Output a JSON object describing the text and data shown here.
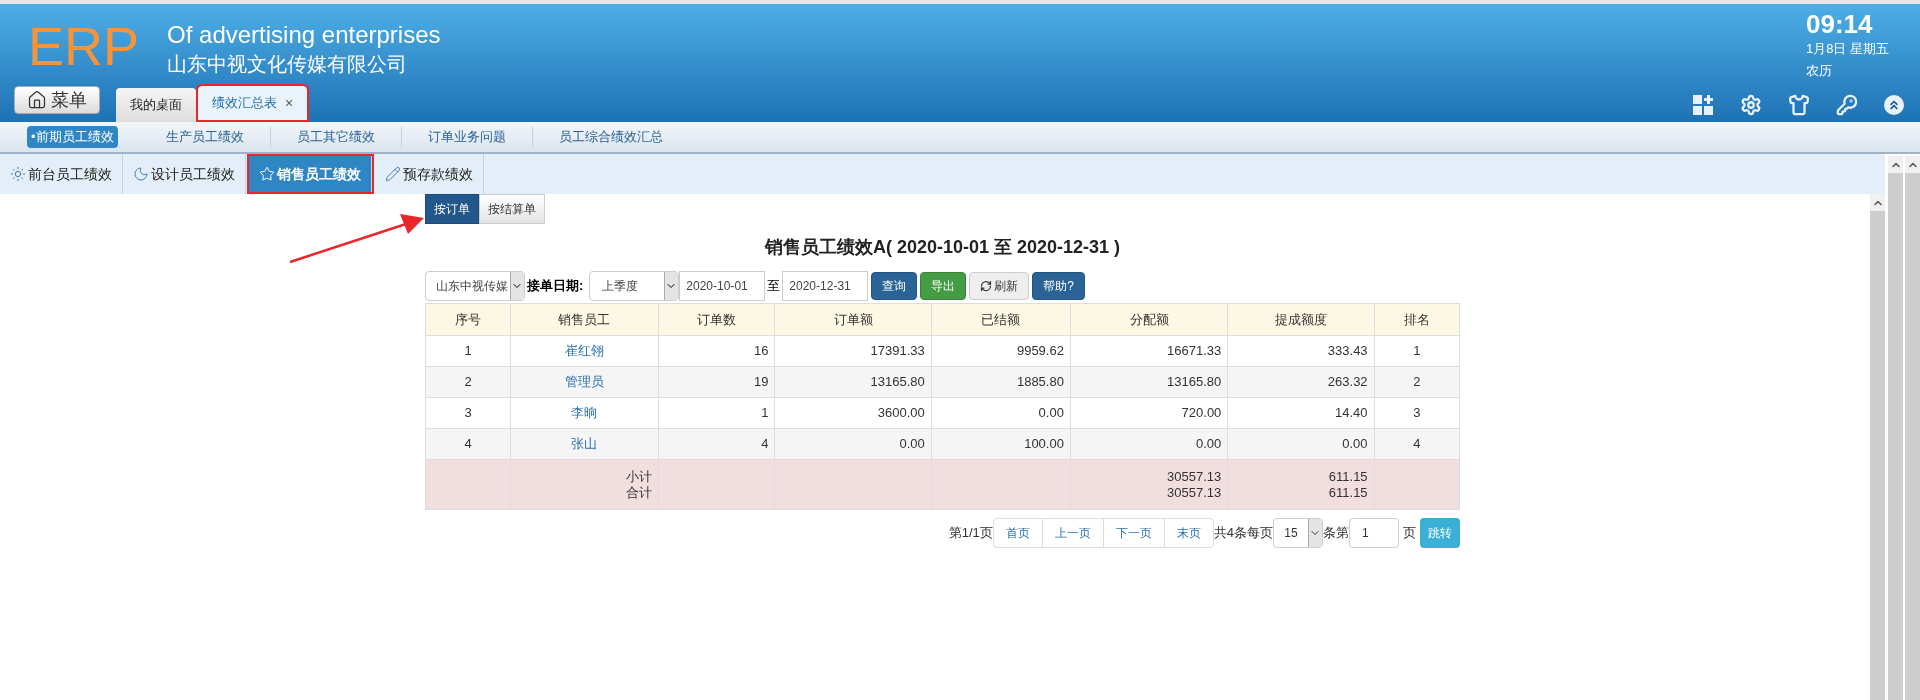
{
  "header": {
    "logo": "ERP",
    "title_en": "Of advertising enterprises",
    "title_cn": "山东中视文化传媒有限公司",
    "menu_button": "菜单",
    "tabs": [
      {
        "label": "我的桌面",
        "selected": false,
        "annotated": false
      },
      {
        "label": "绩效汇总表",
        "selected": true,
        "close": "×",
        "annotated": true
      }
    ],
    "clock": {
      "time": "09:14",
      "date": "1月8日 星期五",
      "lunar": "农历"
    }
  },
  "subnav": [
    {
      "label": "•前期员工绩效",
      "selected": true
    },
    {
      "label": "生产员工绩效",
      "selected": false
    },
    {
      "label": "员工其它绩效",
      "selected": false
    },
    {
      "label": "订单业务问题",
      "selected": false
    },
    {
      "label": "员工综合绩效汇总",
      "selected": false
    }
  ],
  "subtabs": [
    {
      "label": "前台员工绩效",
      "selected": false,
      "annotated": false
    },
    {
      "label": "设计员工绩效",
      "selected": false,
      "annotated": false
    },
    {
      "label": "销售员工绩效",
      "selected": true,
      "annotated": true
    },
    {
      "label": "预存款绩效",
      "selected": false,
      "annotated": false
    }
  ],
  "toggle": [
    {
      "label": "按订单",
      "selected": true
    },
    {
      "label": "按结算单",
      "selected": false
    }
  ],
  "report_title": "销售员工绩效A( 2020-10-01 至 2020-12-31 )",
  "filters": {
    "company": "山东中视传媒",
    "date_label": "接单日期:",
    "period": "上季度",
    "from": "2020-10-01",
    "separator": "至",
    "to": "2020-12-31",
    "buttons": [
      {
        "label": "查询",
        "kind": "primary"
      },
      {
        "label": "导出",
        "kind": "success"
      },
      {
        "label": "刷新",
        "kind": "refresh"
      },
      {
        "label": "帮助?",
        "kind": "primary"
      }
    ]
  },
  "table": {
    "columns": [
      "序号",
      "销售员工",
      "订单数",
      "订单额",
      "已结额",
      "分配额",
      "提成额度",
      "排名"
    ],
    "rows": [
      [
        "1",
        "崔红翎",
        "16",
        "17391.33",
        "9959.62",
        "16671.33",
        "333.43",
        "1"
      ],
      [
        "2",
        "管理员",
        "19",
        "13165.80",
        "1885.80",
        "13165.80",
        "263.32",
        "2"
      ],
      [
        "3",
        "李晌",
        "1",
        "3600.00",
        "0.00",
        "720.00",
        "14.40",
        "3"
      ],
      [
        "4",
        "张山",
        "4",
        "0.00",
        "100.00",
        "0.00",
        "0.00",
        "4"
      ]
    ],
    "summary": [
      {
        "label": "小计",
        "allocated": "30557.13",
        "commission": "611.15"
      },
      {
        "label": "合计",
        "allocated": "30557.13",
        "commission": "611.15"
      }
    ]
  },
  "pagination": {
    "page_info": "第1/1页",
    "links": [
      "首页",
      "上一页",
      "下一页",
      "末页"
    ],
    "total": "共4条每页",
    "page_size": "15",
    "unit": "条第",
    "page": "1",
    "page_suffix": "页",
    "go": "跳转"
  }
}
